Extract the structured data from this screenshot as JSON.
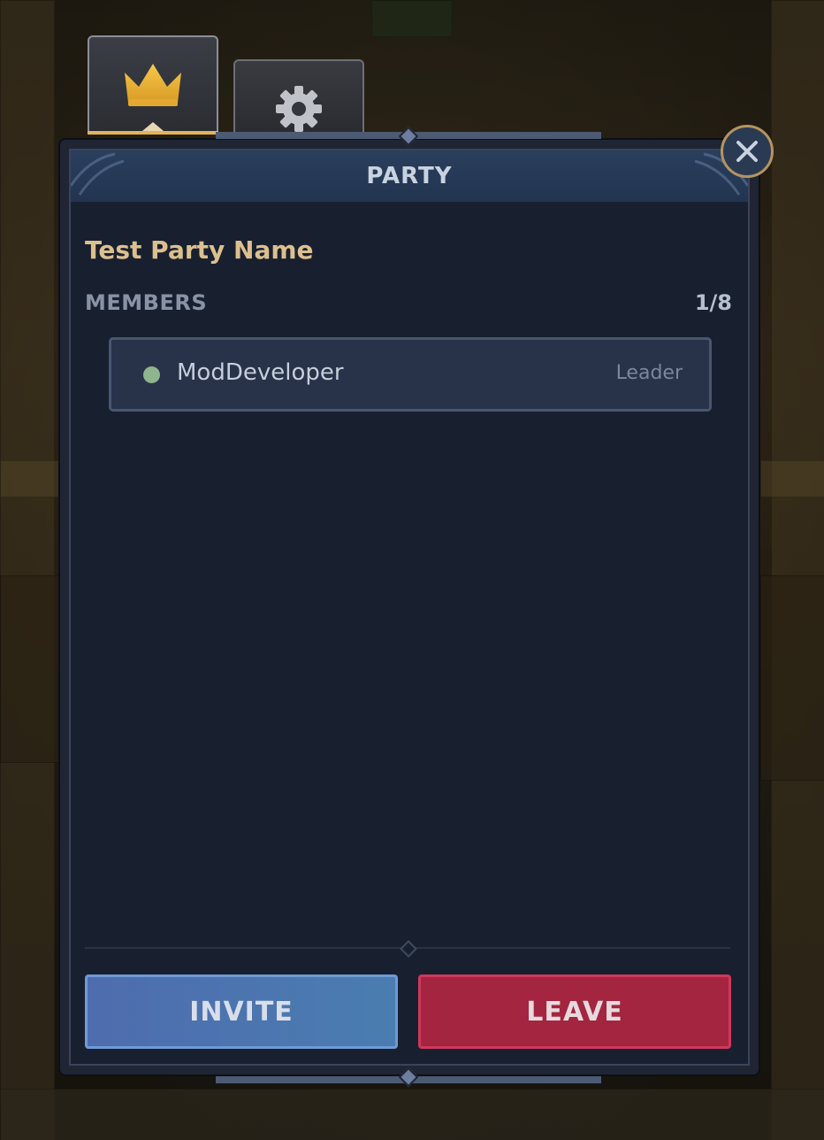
{
  "tabs": [
    {
      "icon": "crown-icon",
      "active": true
    },
    {
      "icon": "gear-icon",
      "active": false
    }
  ],
  "panel": {
    "title": "PARTY",
    "party_name": "Test Party Name",
    "members_label": "MEMBERS",
    "members_count": "1/8",
    "members": [
      {
        "name": "ModDeveloper",
        "role": "Leader",
        "status_color": "#8eb58e"
      }
    ]
  },
  "buttons": {
    "invite": "INVITE",
    "leave": "LEAVE"
  },
  "colors": {
    "accent_gold": "#e1b45a",
    "party_name": "#dcc08e",
    "invite": "#4a7db0",
    "leave": "#a3253f"
  }
}
